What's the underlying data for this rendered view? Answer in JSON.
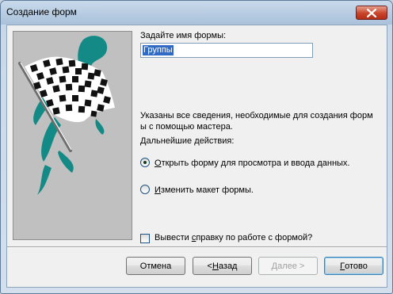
{
  "window": {
    "title": "Создание форм"
  },
  "form_name": {
    "label": "Задайте имя формы:",
    "value": "Группы"
  },
  "info": {
    "line1": "Указаны все сведения, необходимые для создания форм",
    "line2": "ы с помощью мастера."
  },
  "next_actions": {
    "label": "Дальнейшие действия:",
    "options": [
      {
        "prefix": "",
        "accel": "О",
        "rest": "ткрыть форму для просмотра и ввода данных.",
        "selected": true
      },
      {
        "prefix": "",
        "accel": "И",
        "rest": "зменить макет формы.",
        "selected": false
      }
    ]
  },
  "help_checkbox": {
    "prefix": "Вывести ",
    "accel": "с",
    "rest": "правку по работе с формой?",
    "checked": false
  },
  "buttons": {
    "cancel": {
      "prefix": "",
      "accel": "",
      "rest": "Отмена"
    },
    "back": {
      "prefix": "< ",
      "accel": "Н",
      "rest": "азад"
    },
    "next": {
      "prefix": "",
      "accel": "Д",
      "rest": "алее >",
      "enabled": false
    },
    "finish": {
      "prefix": "",
      "accel": "Г",
      "rest": "отово"
    }
  },
  "icons": [
    "close-icon",
    "checkered-flag-icon"
  ]
}
